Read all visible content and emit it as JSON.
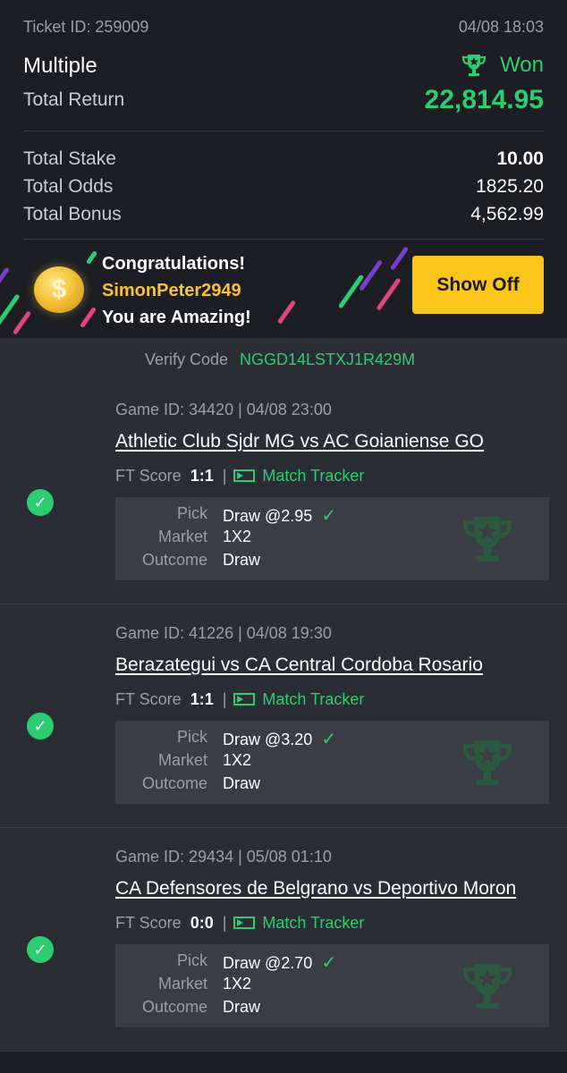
{
  "ticket": {
    "id_text": "Ticket ID: 259009",
    "datetime": "04/08 18:03",
    "bet_type": "Multiple",
    "status": "Won",
    "total_return_label": "Total Return",
    "total_return": "22,814.95",
    "rows": [
      {
        "label": "Total Stake",
        "value": "10.00"
      },
      {
        "label": "Total Odds",
        "value": "1825.20"
      },
      {
        "label": "Total Bonus",
        "value": "4,562.99"
      }
    ]
  },
  "congrats": {
    "line1": "Congratulations!",
    "username": "SimonPeter2949",
    "line3": "You are Amazing!",
    "button": "Show Off",
    "coin_symbol": "$"
  },
  "verify": {
    "label": "Verify Code",
    "code": "NGGD14LSTXJ1R429M"
  },
  "games": [
    {
      "game_id": "Game ID: 34420 | 04/08 23:00",
      "match": "Athletic Club Sjdr MG vs AC Goianiense GO",
      "ft_label": "FT Score",
      "ft_score": "1:1",
      "separator": "|",
      "tracker": "Match Tracker",
      "pick_label": "Pick",
      "pick": "Draw @2.95",
      "market_label": "Market",
      "market": "1X2",
      "outcome_label": "Outcome",
      "outcome": "Draw"
    },
    {
      "game_id": "Game ID: 41226 | 04/08 19:30",
      "match": "Berazategui vs CA Central Cordoba Rosario",
      "ft_label": "FT Score",
      "ft_score": "1:1",
      "separator": "|",
      "tracker": "Match Tracker",
      "pick_label": "Pick",
      "pick": "Draw @3.20",
      "market_label": "Market",
      "market": "1X2",
      "outcome_label": "Outcome",
      "outcome": "Draw"
    },
    {
      "game_id": "Game ID: 29434 | 05/08 01:10",
      "match": "CA Defensores de Belgrano vs Deportivo Moron",
      "ft_label": "FT Score",
      "ft_score": "0:0",
      "separator": "|",
      "tracker": "Match Tracker",
      "pick_label": "Pick",
      "pick": "Draw @2.70",
      "market_label": "Market",
      "market": "1X2",
      "outcome_label": "Outcome",
      "outcome": "Draw"
    }
  ],
  "icons": {
    "won": "trophy-icon",
    "check": "check-circle-icon",
    "tracker": "match-tracker-icon",
    "pick_tick": "checkmark-icon",
    "watermark": "trophy-watermark-icon"
  },
  "colors": {
    "background": "#1c1e23",
    "card": "#2a2d33",
    "detail": "#3a3d44",
    "accent_green": "#2ecc71",
    "button_yellow": "#fbc519",
    "username_yellow": "#f5c23a"
  }
}
